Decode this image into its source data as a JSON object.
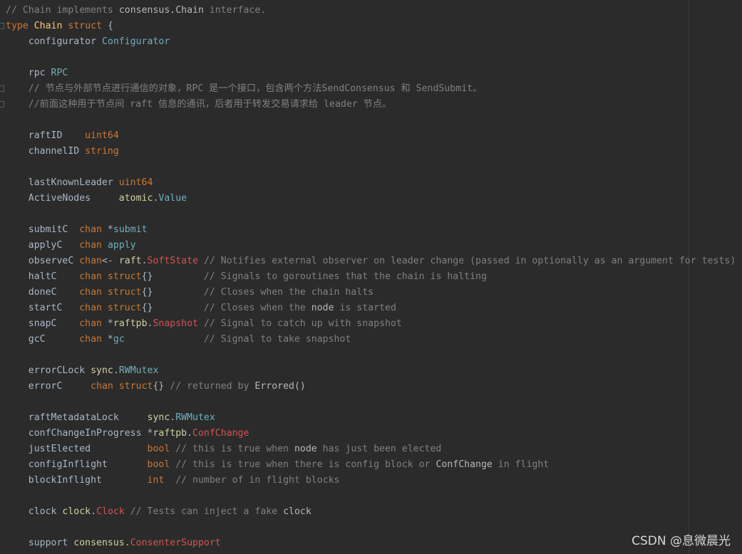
{
  "editor": {
    "language": "go",
    "lines": [
      [
        {
          "t": "// Chain ",
          "c": "cmt"
        },
        {
          "t": "implements",
          "c": "cmt"
        },
        {
          "t": " consensus.Chain ",
          "c": "cmt-hl"
        },
        {
          "t": "interface.",
          "c": "cmt"
        }
      ],
      [
        {
          "t": "type",
          "c": "kw"
        },
        {
          "t": " ",
          "c": "ident"
        },
        {
          "t": "Chain",
          "c": "typename"
        },
        {
          "t": " ",
          "c": "ident"
        },
        {
          "t": "struct",
          "c": "kw"
        },
        {
          "t": " {",
          "c": "ident"
        }
      ],
      [
        {
          "t": "    configurator ",
          "c": "ident"
        },
        {
          "t": "Configurator",
          "c": "typeref"
        }
      ],
      [
        {
          "t": "",
          "c": "ident"
        }
      ],
      [
        {
          "t": "    rpc ",
          "c": "ident"
        },
        {
          "t": "RPC",
          "c": "typeref"
        }
      ],
      [
        {
          "t": "    // 节点与外部节点进行通信的对象，RPC 是一个接口，包含两个方法SendConsensus 和 SendSubmit。",
          "c": "cmt"
        }
      ],
      [
        {
          "t": "    //前面这种用于节点间 raft 信息的通讯，后者用于转发交易请求给 leader 节点。",
          "c": "cmt"
        }
      ],
      [
        {
          "t": "",
          "c": "ident"
        }
      ],
      [
        {
          "t": "    raftID    ",
          "c": "ident"
        },
        {
          "t": "uint64",
          "c": "kw"
        }
      ],
      [
        {
          "t": "    channelID ",
          "c": "ident"
        },
        {
          "t": "string",
          "c": "kw"
        }
      ],
      [
        {
          "t": "",
          "c": "ident"
        }
      ],
      [
        {
          "t": "    lastKnownLeader ",
          "c": "ident"
        },
        {
          "t": "uint64",
          "c": "kw"
        }
      ],
      [
        {
          "t": "    ActiveNodes     ",
          "c": "ident"
        },
        {
          "t": "atomic",
          "c": "pkg"
        },
        {
          "t": ".",
          "c": "ident"
        },
        {
          "t": "Value",
          "c": "typeref"
        }
      ],
      [
        {
          "t": "",
          "c": "ident"
        }
      ],
      [
        {
          "t": "    submitC  ",
          "c": "ident"
        },
        {
          "t": "chan",
          "c": "kw"
        },
        {
          "t": " *",
          "c": "ident"
        },
        {
          "t": "submit",
          "c": "typeref"
        }
      ],
      [
        {
          "t": "    applyC   ",
          "c": "ident"
        },
        {
          "t": "chan",
          "c": "kw"
        },
        {
          "t": " ",
          "c": "ident"
        },
        {
          "t": "apply",
          "c": "typeref"
        }
      ],
      [
        {
          "t": "    observeC ",
          "c": "ident"
        },
        {
          "t": "chan",
          "c": "kw"
        },
        {
          "t": "<- ",
          "c": "ident"
        },
        {
          "t": "raft",
          "c": "pkg"
        },
        {
          "t": ".",
          "c": "ident"
        },
        {
          "t": "SoftState",
          "c": "red"
        },
        {
          "t": " // Notifies external observer on leader change (passed in optionally as an argument for tests)",
          "c": "cmt"
        }
      ],
      [
        {
          "t": "    haltC    ",
          "c": "ident"
        },
        {
          "t": "chan",
          "c": "kw"
        },
        {
          "t": " ",
          "c": "ident"
        },
        {
          "t": "struct",
          "c": "kw"
        },
        {
          "t": "{}         ",
          "c": "ident"
        },
        {
          "t": "// Signals to goroutines that the chain is halting",
          "c": "cmt"
        }
      ],
      [
        {
          "t": "    doneC    ",
          "c": "ident"
        },
        {
          "t": "chan",
          "c": "kw"
        },
        {
          "t": " ",
          "c": "ident"
        },
        {
          "t": "struct",
          "c": "kw"
        },
        {
          "t": "{}         ",
          "c": "ident"
        },
        {
          "t": "// Closes when the chain halts",
          "c": "cmt"
        }
      ],
      [
        {
          "t": "    startC   ",
          "c": "ident"
        },
        {
          "t": "chan",
          "c": "kw"
        },
        {
          "t": " ",
          "c": "ident"
        },
        {
          "t": "struct",
          "c": "kw"
        },
        {
          "t": "{}         ",
          "c": "ident"
        },
        {
          "t": "// Closes when the ",
          "c": "cmt"
        },
        {
          "t": "node",
          "c": "cmt-hl"
        },
        {
          "t": " is started",
          "c": "cmt"
        }
      ],
      [
        {
          "t": "    snapC    ",
          "c": "ident"
        },
        {
          "t": "chan",
          "c": "kw"
        },
        {
          "t": " *",
          "c": "ident"
        },
        {
          "t": "raftpb",
          "c": "pkg"
        },
        {
          "t": ".",
          "c": "ident"
        },
        {
          "t": "Snapshot",
          "c": "red"
        },
        {
          "t": " // Signal to catch up with snapshot",
          "c": "cmt"
        }
      ],
      [
        {
          "t": "    gcC      ",
          "c": "ident"
        },
        {
          "t": "chan",
          "c": "kw"
        },
        {
          "t": " *",
          "c": "ident"
        },
        {
          "t": "gc",
          "c": "typeref"
        },
        {
          "t": "              ",
          "c": "ident"
        },
        {
          "t": "// Signal to take snapshot",
          "c": "cmt"
        }
      ],
      [
        {
          "t": "",
          "c": "ident"
        }
      ],
      [
        {
          "t": "    errorCLock ",
          "c": "ident"
        },
        {
          "t": "sync",
          "c": "pkg"
        },
        {
          "t": ".",
          "c": "ident"
        },
        {
          "t": "RWMutex",
          "c": "typeref"
        }
      ],
      [
        {
          "t": "    errorC     ",
          "c": "ident"
        },
        {
          "t": "chan",
          "c": "kw"
        },
        {
          "t": " ",
          "c": "ident"
        },
        {
          "t": "struct",
          "c": "kw"
        },
        {
          "t": "{} ",
          "c": "ident"
        },
        {
          "t": "// returned by ",
          "c": "cmt"
        },
        {
          "t": "Errored()",
          "c": "cmt-hl"
        }
      ],
      [
        {
          "t": "",
          "c": "ident"
        }
      ],
      [
        {
          "t": "    raftMetadataLock     ",
          "c": "ident"
        },
        {
          "t": "sync",
          "c": "pkg"
        },
        {
          "t": ".",
          "c": "ident"
        },
        {
          "t": "RWMutex",
          "c": "typeref"
        }
      ],
      [
        {
          "t": "    confChangeInProgress *",
          "c": "ident"
        },
        {
          "t": "raftpb",
          "c": "pkg"
        },
        {
          "t": ".",
          "c": "ident"
        },
        {
          "t": "ConfChange",
          "c": "red"
        }
      ],
      [
        {
          "t": "    justElected          ",
          "c": "ident"
        },
        {
          "t": "bool",
          "c": "kw"
        },
        {
          "t": " // this is true when ",
          "c": "cmt"
        },
        {
          "t": "node",
          "c": "cmt-hl"
        },
        {
          "t": " has just been elected",
          "c": "cmt"
        }
      ],
      [
        {
          "t": "    configInflight       ",
          "c": "ident"
        },
        {
          "t": "bool",
          "c": "kw"
        },
        {
          "t": " // this is true when there is config block or ",
          "c": "cmt"
        },
        {
          "t": "ConfChange",
          "c": "cmt-hl"
        },
        {
          "t": " in flight",
          "c": "cmt"
        }
      ],
      [
        {
          "t": "    blockInflight        ",
          "c": "ident"
        },
        {
          "t": "int",
          "c": "kw"
        },
        {
          "t": "  // number of in flight blocks",
          "c": "cmt"
        }
      ],
      [
        {
          "t": "",
          "c": "ident"
        }
      ],
      [
        {
          "t": "    clock ",
          "c": "ident"
        },
        {
          "t": "clock",
          "c": "pkg"
        },
        {
          "t": ".",
          "c": "ident"
        },
        {
          "t": "Clock",
          "c": "red"
        },
        {
          "t": " // Tests can inject a fake ",
          "c": "cmt"
        },
        {
          "t": "clock",
          "c": "cmt-hl"
        }
      ],
      [
        {
          "t": "",
          "c": "ident"
        }
      ],
      [
        {
          "t": "    support ",
          "c": "ident"
        },
        {
          "t": "consensus",
          "c": "pkg"
        },
        {
          "t": ".",
          "c": "ident"
        },
        {
          "t": "ConsenterSupport",
          "c": "red"
        }
      ]
    ]
  },
  "watermark": {
    "text": "CSDN @息微晨光"
  }
}
